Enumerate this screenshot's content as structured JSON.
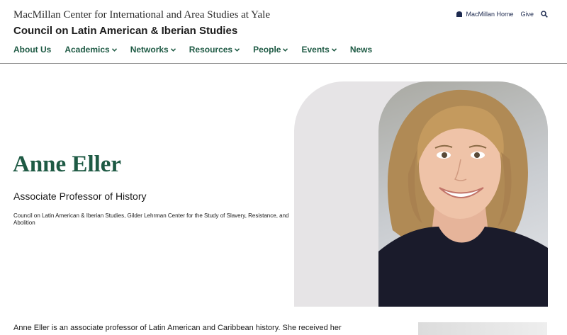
{
  "header": {
    "center_name": "MacMillan Center for International and Area Studies at Yale",
    "council_name": "Council on Latin American & Iberian Studies"
  },
  "utility": {
    "home_label": "MacMillan Home",
    "give_label": "Give",
    "home_icon": "home-icon",
    "search_icon": "search-icon"
  },
  "nav": {
    "items": [
      {
        "label": "About Us",
        "has_dropdown": false
      },
      {
        "label": "Academics",
        "has_dropdown": true
      },
      {
        "label": "Networks",
        "has_dropdown": true
      },
      {
        "label": "Resources",
        "has_dropdown": true
      },
      {
        "label": "People",
        "has_dropdown": true
      },
      {
        "label": "Events",
        "has_dropdown": true
      },
      {
        "label": "News",
        "has_dropdown": false
      }
    ]
  },
  "profile": {
    "name": "Anne Eller",
    "title": "Associate Professor of History",
    "affiliations": "Council on Latin American & Iberian Studies, Gilder Lehrman Center for the Study of Slavery, Resistance, and Abolition",
    "bio_start": "Anne Eller is an associate professor of Latin American and Caribbean history.  She received her"
  },
  "colors": {
    "brand_green": "#1e5a44",
    "utility_navy": "#1d2a4f",
    "arch_gray": "#e6e4e6"
  }
}
